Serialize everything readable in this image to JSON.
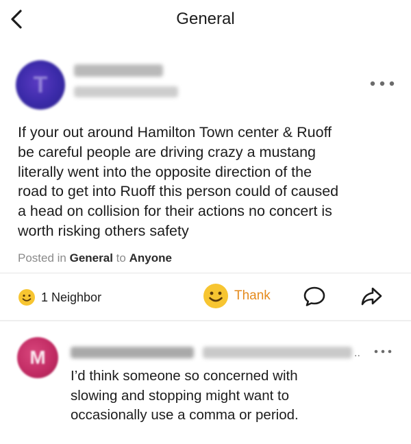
{
  "header": {
    "title": "General",
    "back_icon": "chevron-left-icon"
  },
  "post": {
    "author_avatar_glyph": "T",
    "body": "If your out around Hamilton Town center & Ruoff\nbe careful people are driving crazy a mustang\nliterally went into the opposite direction of the\nroad to get into Ruoff this person could of caused\na head on collision for their actions no concert is\nworth risking others safety",
    "posted_prefix": "Posted in",
    "posted_group": "General",
    "posted_to": "to",
    "posted_audience": "Anyone",
    "more_icon": "more-horizontal-icon"
  },
  "reactions": {
    "summary_label": "1 Neighbor",
    "summary_icon": "smiley-icon",
    "thank_label": "Thank",
    "thank_icon": "smiley-icon",
    "comment_icon": "comment-bubble-icon",
    "share_icon": "share-arrow-icon"
  },
  "comment": {
    "author_avatar_glyph": "M",
    "name_truncation": "..",
    "body": "I’d think someone so concerned with\nslowing and stopping might want to\noccasionally use a comma or period.",
    "more_icon": "more-horizontal-icon"
  },
  "colors": {
    "accent_orange": "#e48a1c",
    "smiley_yellow": "#f7c531",
    "avatar_main": "#3a2aa8",
    "avatar_comment": "#c02a62"
  }
}
